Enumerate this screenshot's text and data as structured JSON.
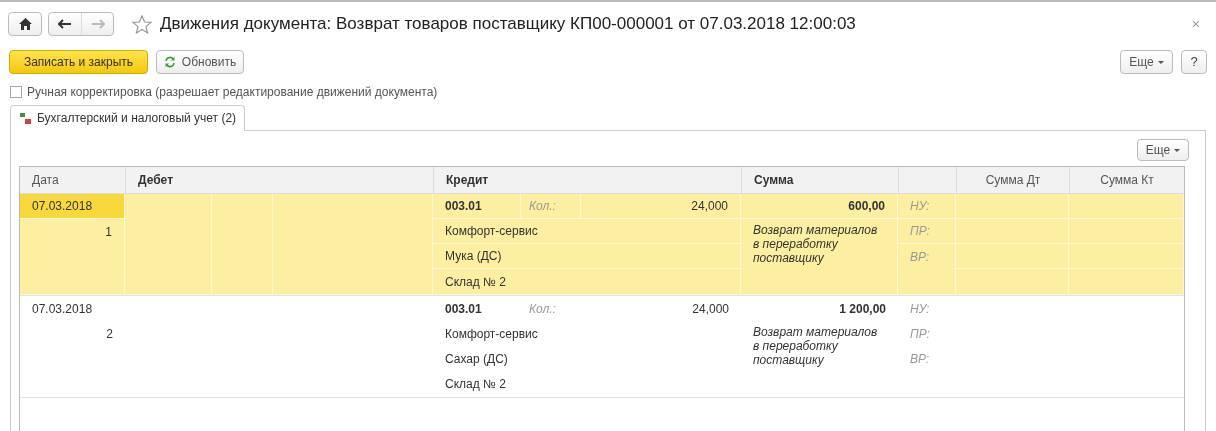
{
  "window": {
    "title": "Движения документа: Возврат товаров поставщику КП00-000001 от 07.03.2018 12:00:03",
    "close": "×"
  },
  "nav": [
    {
      "kind": "back",
      "disabled": false
    },
    {
      "kind": "forward",
      "disabled": true
    }
  ],
  "toolbar": {
    "primary": "Записать и закрыть",
    "refresh": "Обновить",
    "more": "Еще",
    "help": "?"
  },
  "manual_edit": {
    "label": "Ручная корректировка (разрешает редактирование движений документа)",
    "checked": false
  },
  "tabs": [
    {
      "label": "Бухгалтерский и налоговый учет (2)",
      "selected": true
    }
  ],
  "table": {
    "more": "Еще",
    "columns": [
      "Дата",
      "Дебет",
      "Кредит",
      "Сумма",
      "Сумма Дт",
      "Сумма Кт"
    ],
    "rows": [
      {
        "selected": true,
        "date": "07.03.2018",
        "number": "1",
        "credit": {
          "account": "003.01",
          "qty_label": "Кол.:",
          "qty": "24,000",
          "lines": [
            "Комфорт-сервис",
            "Мука (ДС)",
            "Склад № 2"
          ]
        },
        "amount": "600,00",
        "content": "Возврат материалов в переработку поставщику",
        "tax_labels": [
          "НУ:",
          "ПР:",
          "ВР:"
        ]
      },
      {
        "selected": false,
        "date": "07.03.2018",
        "number": "2",
        "credit": {
          "account": "003.01",
          "qty_label": "Кол.:",
          "qty": "24,000",
          "lines": [
            "Комфорт-сервис",
            "Сахар (ДС)",
            "Склад № 2"
          ]
        },
        "amount": "1 200,00",
        "content": "Возврат материалов в переработку поставщику",
        "tax_labels": [
          "НУ:",
          "ПР:",
          "ВР:"
        ]
      }
    ]
  }
}
